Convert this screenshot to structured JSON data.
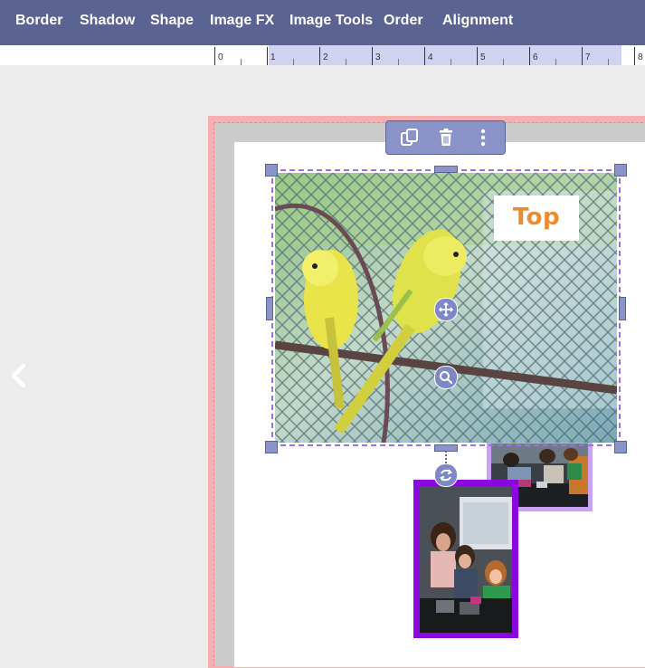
{
  "toolbar": {
    "items": [
      "Border",
      "Shadow",
      "Shape",
      "Image FX",
      "Image Tools",
      "Order",
      "Alignment"
    ],
    "background": "#5b6392"
  },
  "ruler": {
    "numbers": [
      "0",
      "1",
      "2",
      "3",
      "4",
      "5",
      "6",
      "7",
      "8"
    ]
  },
  "canvas": {
    "text_box": {
      "text": "Top",
      "color": "#ef8b2f"
    },
    "selection_color": "#9e70e8",
    "front_photo_frame_color": "#8b07e0",
    "back_photo_frame_color": "#c7a3f0",
    "bleed_color": "#f6b0b2"
  },
  "icons": {
    "prev": "chevron-left-icon",
    "duplicate": "duplicate-icon",
    "delete": "trash-icon",
    "more": "more-vertical-icon",
    "move": "move-icon",
    "zoom": "zoom-icon",
    "rotate": "rotate-icon"
  }
}
